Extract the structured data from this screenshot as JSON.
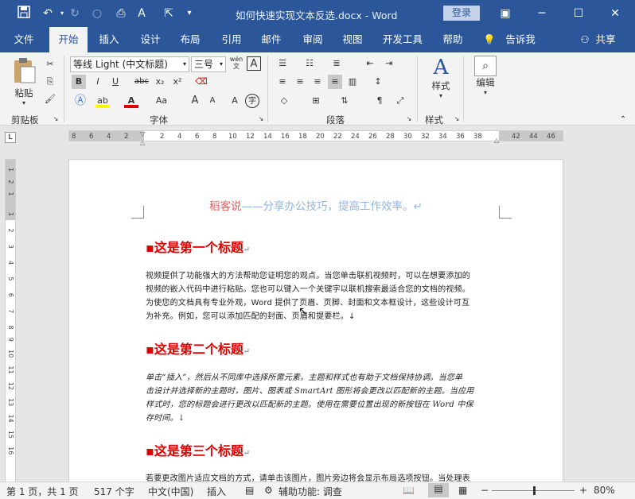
{
  "window": {
    "title": "如何快速实现文本反选.docx  -  Word",
    "login": "登录"
  },
  "tabs": [
    "文件",
    "开始",
    "插入",
    "设计",
    "布局",
    "引用",
    "邮件",
    "审阅",
    "视图",
    "开发工具",
    "帮助",
    "告诉我",
    "共享"
  ],
  "active_tab": "开始",
  "ribbon": {
    "clipboard": {
      "label": "剪贴板",
      "paste": "粘贴"
    },
    "font": {
      "label": "字体",
      "font_name": "等线 Light (中文标题)",
      "font_size": "三号",
      "wen": "wén\n文",
      "A_box": "A",
      "bold": "B",
      "italic": "I",
      "underline": "U",
      "strike": "abc",
      "sub": "x₂",
      "sup": "x²",
      "grow": "A",
      "shrink": "A",
      "case": "Aa",
      "circle": "字"
    },
    "paragraph": {
      "label": "段落"
    },
    "styles": {
      "label": "样式",
      "btn": "样式"
    },
    "editing": {
      "btn": "编辑"
    }
  },
  "ruler": {
    "h": [
      "8",
      "6",
      "4",
      "2",
      "2",
      "4",
      "6",
      "8",
      "10",
      "12",
      "14",
      "16",
      "18",
      "20",
      "22",
      "24",
      "26",
      "28",
      "30",
      "32",
      "34",
      "36",
      "38",
      "42",
      "44",
      "46",
      "48"
    ],
    "v": [
      "1",
      "2",
      "1",
      "1",
      "2",
      "3",
      "4",
      "5",
      "6",
      "7",
      "8",
      "9",
      "10",
      "11",
      "12",
      "13",
      "14",
      "15",
      "16",
      "17",
      "18",
      "19"
    ]
  },
  "document": {
    "header": {
      "part1": "稻客说",
      "part2": "——分享办公技巧，提高工作效率。↵"
    },
    "h1": "这是第一个标题",
    "p1": [
      "视频提供了功能强大的方法帮助您证明您的观点。当您单击联机视频时，可以在想要添加的",
      "视频的嵌入代码中进行粘贴。您也可以键入一个关键字以联机搜索最适合您的文档的视频。",
      "为使您的文档具有专业外观，Word 提供了页眉、页脚、封面和文本框设计，这些设计可互",
      "为补充。例如，您可以添加匹配的封面、页眉和提要栏。↓"
    ],
    "h2": "这是第二个标题",
    "p2": [
      "单击“插入”，然后从不同库中选择所需元素。主题和样式也有助于文档保持协调。当您单",
      "击设计并选择新的主题时，图片、图表或 SmartArt 图形将会更改以匹配新的主题。当应用",
      "样式时，您的标题会进行更改以匹配新的主题。使用在需要位置出现的新按钮在 Word 中保",
      "存时间。↓"
    ],
    "h3": "这是第三个标题",
    "p3": [
      "若要更改图片适应文档的方式，请单击该图片，图片旁边将会显示布局选项按钮。当处理表"
    ]
  },
  "status": {
    "page": "第 1 页，共 1 页",
    "words": "517 个字",
    "lang": "中文(中国)",
    "insert": "插入",
    "access": "辅助功能: 调查",
    "zoom": "80%",
    "minus": "−",
    "plus": "+"
  },
  "colors": {
    "brand": "#2b579a",
    "heading": "#e00000",
    "header_red": "#e06060",
    "header_blue": "#8fb4e8"
  }
}
